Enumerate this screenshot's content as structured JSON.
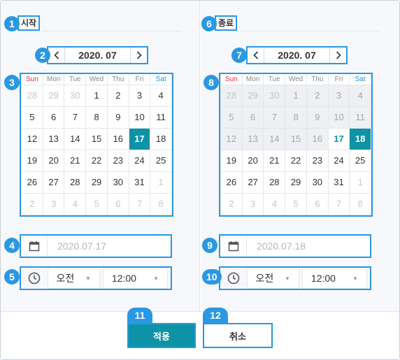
{
  "badges": [
    "1",
    "2",
    "3",
    "4",
    "5",
    "6",
    "7",
    "8",
    "9",
    "10",
    "11",
    "12"
  ],
  "start": {
    "title": "시작",
    "month_label": "2020. 07",
    "date_value": "2020.07.17",
    "ampm": "오전",
    "time": "12:00",
    "days": [
      [
        {
          "d": "28",
          "o": true
        },
        {
          "d": "29",
          "o": true
        },
        {
          "d": "30",
          "o": true
        },
        {
          "d": "1"
        },
        {
          "d": "2"
        },
        {
          "d": "3"
        },
        {
          "d": "4"
        }
      ],
      [
        {
          "d": "5"
        },
        {
          "d": "6"
        },
        {
          "d": "7"
        },
        {
          "d": "8"
        },
        {
          "d": "9"
        },
        {
          "d": "10"
        },
        {
          "d": "11"
        }
      ],
      [
        {
          "d": "12"
        },
        {
          "d": "13"
        },
        {
          "d": "14"
        },
        {
          "d": "15"
        },
        {
          "d": "16"
        },
        {
          "d": "17",
          "s": true
        },
        {
          "d": "18"
        }
      ],
      [
        {
          "d": "19"
        },
        {
          "d": "20"
        },
        {
          "d": "21"
        },
        {
          "d": "22"
        },
        {
          "d": "23"
        },
        {
          "d": "24"
        },
        {
          "d": "25"
        }
      ],
      [
        {
          "d": "26"
        },
        {
          "d": "27"
        },
        {
          "d": "28"
        },
        {
          "d": "29"
        },
        {
          "d": "30"
        },
        {
          "d": "31"
        },
        {
          "d": "1",
          "o": true
        }
      ],
      [
        {
          "d": "2",
          "o": true
        },
        {
          "d": "3",
          "o": true
        },
        {
          "d": "4",
          "o": true
        },
        {
          "d": "5",
          "o": true
        },
        {
          "d": "6",
          "o": true
        },
        {
          "d": "7",
          "o": true
        },
        {
          "d": "8",
          "o": true
        }
      ]
    ]
  },
  "end": {
    "title": "종료",
    "month_label": "2020. 07",
    "date_value": "2020.07.18",
    "ampm": "오전",
    "time": "12:00",
    "days": [
      [
        {
          "d": "28",
          "o": true,
          "x": true
        },
        {
          "d": "29",
          "o": true,
          "x": true
        },
        {
          "d": "30",
          "o": true,
          "x": true
        },
        {
          "d": "1",
          "x": true
        },
        {
          "d": "2",
          "x": true
        },
        {
          "d": "3",
          "x": true
        },
        {
          "d": "4",
          "x": true
        }
      ],
      [
        {
          "d": "5",
          "x": true
        },
        {
          "d": "6",
          "x": true
        },
        {
          "d": "7",
          "x": true
        },
        {
          "d": "8",
          "x": true
        },
        {
          "d": "9",
          "x": true
        },
        {
          "d": "10",
          "x": true
        },
        {
          "d": "11",
          "x": true
        }
      ],
      [
        {
          "d": "12",
          "x": true
        },
        {
          "d": "13",
          "x": true
        },
        {
          "d": "14",
          "x": true
        },
        {
          "d": "15",
          "x": true
        },
        {
          "d": "16",
          "x": true
        },
        {
          "d": "17",
          "st": true
        },
        {
          "d": "18",
          "s": true
        }
      ],
      [
        {
          "d": "19"
        },
        {
          "d": "20"
        },
        {
          "d": "21"
        },
        {
          "d": "22"
        },
        {
          "d": "23"
        },
        {
          "d": "24"
        },
        {
          "d": "25"
        }
      ],
      [
        {
          "d": "26"
        },
        {
          "d": "27"
        },
        {
          "d": "28"
        },
        {
          "d": "29"
        },
        {
          "d": "30"
        },
        {
          "d": "31"
        },
        {
          "d": "1",
          "o": true
        }
      ],
      [
        {
          "d": "2",
          "o": true
        },
        {
          "d": "3",
          "o": true
        },
        {
          "d": "4",
          "o": true
        },
        {
          "d": "5",
          "o": true
        },
        {
          "d": "6",
          "o": true
        },
        {
          "d": "7",
          "o": true
        },
        {
          "d": "8",
          "o": true
        }
      ]
    ]
  },
  "weekdays": [
    "Sun",
    "Mon",
    "Tue",
    "Wed",
    "Thu",
    "Fri",
    "Sat"
  ],
  "buttons": {
    "apply": "적용",
    "cancel": "취소"
  },
  "icons": {
    "prev": "chevron-left-icon",
    "next": "chevron-right-icon",
    "calendar": "calendar-icon",
    "clock": "clock-icon",
    "dropdown": "caret-down-icon"
  },
  "colors": {
    "accent": "#2a98e2",
    "selected": "#0e93a6",
    "sunday": "#e0304a",
    "saturday": "#2a8fd4"
  }
}
